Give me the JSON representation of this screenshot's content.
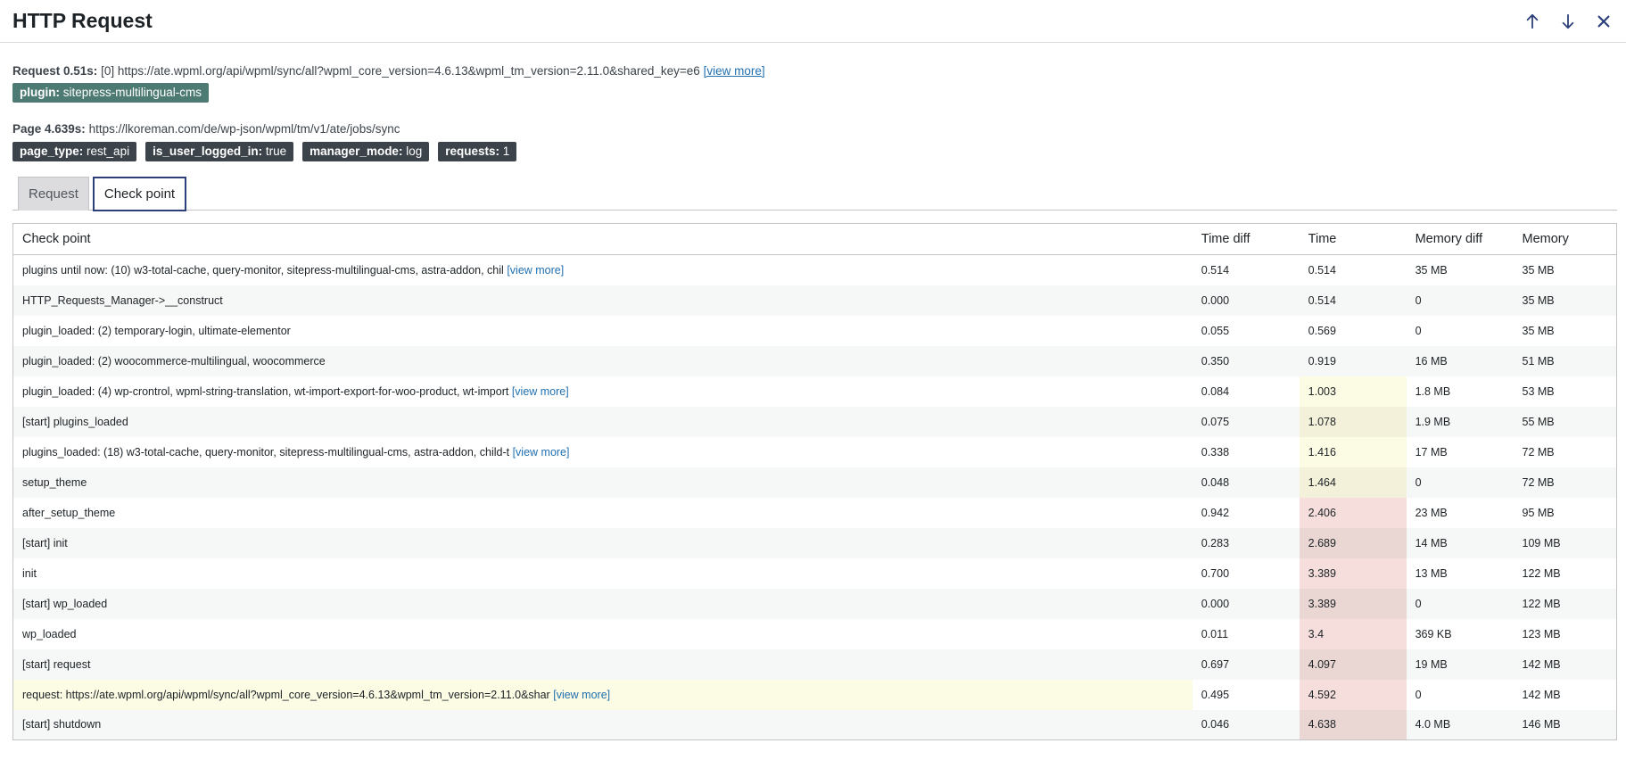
{
  "header": {
    "title": "HTTP Request",
    "icons": [
      "arrow-up-icon",
      "arrow-down-icon",
      "close-icon"
    ]
  },
  "request": {
    "label": "Request 0.51s:",
    "value": "[0] https://ate.wpml.org/api/wpml/sync/all?wpml_core_version=4.6.13&wpml_tm_version=2.11.0&shared_key=e6",
    "view_more": "[view more]",
    "plugin_badge_key": "plugin:",
    "plugin_badge_val": "sitepress-multilingual-cms"
  },
  "page": {
    "label": "Page 4.639s:",
    "value": "https://lkoreman.com/de/wp-json/wpml/tm/v1/ate/jobs/sync",
    "badges": [
      {
        "key": "page_type:",
        "val": "rest_api"
      },
      {
        "key": "is_user_logged_in:",
        "val": "true"
      },
      {
        "key": "manager_mode:",
        "val": "log"
      },
      {
        "key": "requests:",
        "val": "1"
      }
    ]
  },
  "tabs": [
    {
      "label": "Request",
      "active": false
    },
    {
      "label": "Check point",
      "active": true
    }
  ],
  "table": {
    "columns": [
      "Check point",
      "Time diff",
      "Time",
      "Memory diff",
      "Memory"
    ],
    "view_more": "[view more]",
    "rows": [
      {
        "cp": "plugins until now: (10) w3-total-cache, query-monitor, sitepress-multilingual-cms, astra-addon, chil",
        "vm": true,
        "td": "0.514",
        "t": "0.514",
        "md": "35 MB",
        "m": "35 MB",
        "thl": ""
      },
      {
        "cp": "HTTP_Requests_Manager->__construct",
        "vm": false,
        "td": "0.000",
        "t": "0.514",
        "md": "0",
        "m": "35 MB",
        "thl": ""
      },
      {
        "cp": "plugin_loaded: (2) temporary-login, ultimate-elementor",
        "vm": false,
        "td": "0.055",
        "t": "0.569",
        "md": "0",
        "m": "35 MB",
        "thl": ""
      },
      {
        "cp": "plugin_loaded: (2) woocommerce-multilingual, woocommerce",
        "vm": false,
        "td": "0.350",
        "t": "0.919",
        "md": "16 MB",
        "m": "51 MB",
        "thl": ""
      },
      {
        "cp": "plugin_loaded: (4) wp-crontrol, wpml-string-translation, wt-import-export-for-woo-product, wt-import",
        "vm": true,
        "td": "0.084",
        "t": "1.003",
        "md": "1.8 MB",
        "m": "53 MB",
        "thl": "yellow"
      },
      {
        "cp": "[start] plugins_loaded",
        "vm": false,
        "td": "0.075",
        "t": "1.078",
        "md": "1.9 MB",
        "m": "55 MB",
        "thl": "yellow"
      },
      {
        "cp": "plugins_loaded: (18) w3-total-cache, query-monitor, sitepress-multilingual-cms, astra-addon, child-t",
        "vm": true,
        "td": "0.338",
        "t": "1.416",
        "md": "17 MB",
        "m": "72 MB",
        "thl": "yellow"
      },
      {
        "cp": "setup_theme",
        "vm": false,
        "td": "0.048",
        "t": "1.464",
        "md": "0",
        "m": "72 MB",
        "thl": "yellow"
      },
      {
        "cp": "after_setup_theme",
        "vm": false,
        "td": "0.942",
        "t": "2.406",
        "md": "23 MB",
        "m": "95 MB",
        "thl": "red"
      },
      {
        "cp": "[start] init",
        "vm": false,
        "td": "0.283",
        "t": "2.689",
        "md": "14 MB",
        "m": "109 MB",
        "thl": "red"
      },
      {
        "cp": "init",
        "vm": false,
        "td": "0.700",
        "t": "3.389",
        "md": "13 MB",
        "m": "122 MB",
        "thl": "red"
      },
      {
        "cp": "[start] wp_loaded",
        "vm": false,
        "td": "0.000",
        "t": "3.389",
        "md": "0",
        "m": "122 MB",
        "thl": "red"
      },
      {
        "cp": "wp_loaded",
        "vm": false,
        "td": "0.011",
        "t": "3.4",
        "md": "369 KB",
        "m": "123 MB",
        "thl": "red"
      },
      {
        "cp": "[start] request",
        "vm": false,
        "td": "0.697",
        "t": "4.097",
        "md": "19 MB",
        "m": "142 MB",
        "thl": "red"
      },
      {
        "cp": "request: https://ate.wpml.org/api/wpml/sync/all?wpml_core_version=4.6.13&wpml_tm_version=2.11.0&shar",
        "vm": true,
        "td": "0.495",
        "t": "4.592",
        "md": "0",
        "m": "142 MB",
        "thl": "red",
        "rowhl": true
      },
      {
        "cp": "[start] shutdown",
        "vm": false,
        "td": "0.046",
        "t": "4.638",
        "md": "4.0 MB",
        "m": "146 MB",
        "thl": "red"
      }
    ]
  }
}
